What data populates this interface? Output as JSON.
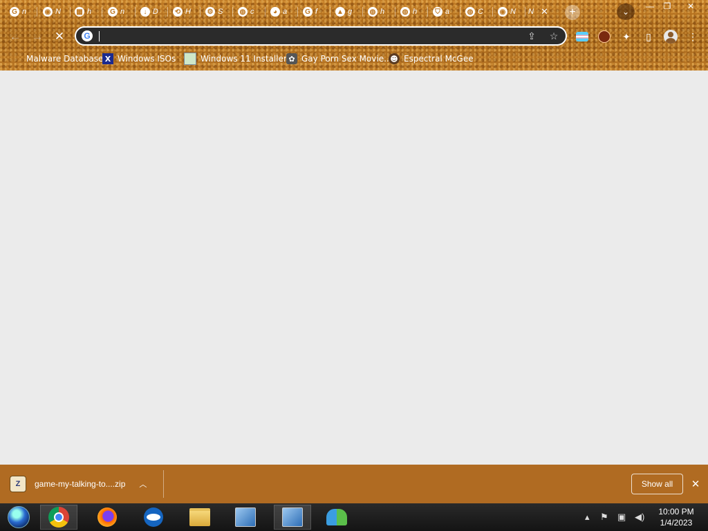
{
  "window": {
    "minimize": "—",
    "restore": "❐",
    "close": "✕"
  },
  "tabs": [
    {
      "favicon": "G",
      "title": "n"
    },
    {
      "favicon": "◉",
      "title": "N"
    },
    {
      "favicon": "▦",
      "title": "h"
    },
    {
      "favicon": "G",
      "title": "n"
    },
    {
      "favicon": "↓",
      "title": "D"
    },
    {
      "favicon": "⟲",
      "title": "H"
    },
    {
      "favicon": "⚙",
      "title": "S"
    },
    {
      "favicon": "◍",
      "title": "c"
    },
    {
      "favicon": "◕",
      "title": "a"
    },
    {
      "favicon": "G",
      "title": "f"
    },
    {
      "favicon": "▲",
      "title": "g"
    },
    {
      "favicon": "◍",
      "title": "h"
    },
    {
      "favicon": "◍",
      "title": "h"
    },
    {
      "favicon": "⛉",
      "title": "a"
    },
    {
      "favicon": "◍",
      "title": "C"
    },
    {
      "favicon": "◉",
      "title": "N"
    }
  ],
  "active_tab": {
    "title": "N",
    "close": "✕"
  },
  "new_tab": "+",
  "tab_search": "⌄",
  "nav": {
    "back": "←",
    "forward": "→",
    "stop": "✕"
  },
  "omnibox": {
    "value": "",
    "placeholder": "",
    "share": "⇪",
    "star": "☆"
  },
  "toolbar_right": {
    "extensions": "✦",
    "sidepanel": "▯",
    "menu": "⋮"
  },
  "bookmarks": [
    {
      "label": "Malware Database",
      "icon": ""
    },
    {
      "label": "Windows ISOs",
      "icon": "X"
    },
    {
      "label": "Windows 11 Installer",
      "icon": ""
    },
    {
      "label": "Gay Porn Sex Movie...",
      "icon": "✿"
    },
    {
      "label": "Espectral McGee",
      "icon": "☻"
    }
  ],
  "download_shelf": {
    "file": "game-my-talking-to....zip",
    "file_icon": "Z",
    "chevron": "︿",
    "show_all": "Show all",
    "close": "✕"
  },
  "taskbar": {
    "tray_arrow": "▴",
    "time": "10:00 PM",
    "date": "1/4/2023"
  },
  "colors": {
    "chrome_accent": "#b06f1e",
    "download_shelf": "#b06b22",
    "page_background": "#ebebeb",
    "omnibox": "#2b2b2b"
  }
}
